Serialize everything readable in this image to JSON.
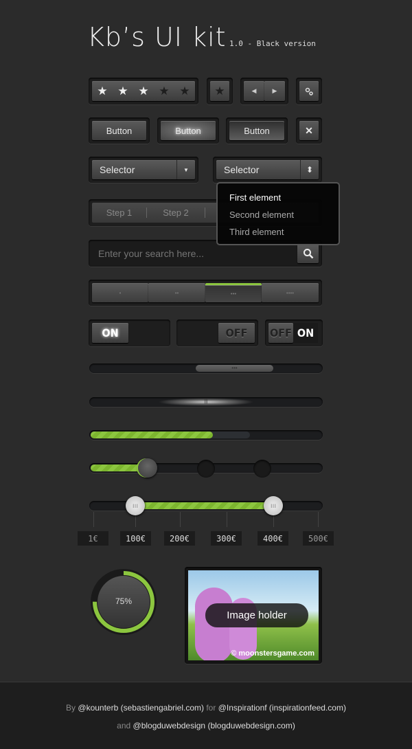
{
  "header": {
    "title": "Kb’s UI kit",
    "subtitle": "1.0 - Black version"
  },
  "rating": {
    "value": 3,
    "max": 5,
    "star_glyph": "★"
  },
  "favorite": {
    "glyph": "★"
  },
  "pager": {
    "prev": "◀",
    "next": "▶"
  },
  "buttons": [
    "Button",
    "Button",
    "Button"
  ],
  "close": {
    "glyph": "✕"
  },
  "selectors": [
    {
      "value": "Selector",
      "icon": "chevron-down-icon",
      "glyph": "▼"
    },
    {
      "value": "Selector",
      "icon": "up-down-icon",
      "glyph": "⬍"
    }
  ],
  "dropdown": {
    "items": [
      "First element",
      "Second element",
      "Third element"
    ],
    "selected": 0
  },
  "steps": [
    "Step 1",
    "Step 2"
  ],
  "search": {
    "placeholder": "Enter your search here..."
  },
  "segments": {
    "labels": [
      "•",
      "••",
      "•••",
      "••••"
    ],
    "active": 2
  },
  "toggles": [
    {
      "label": "ON",
      "state": "on"
    },
    {
      "label": "OFF",
      "state": "off"
    },
    {
      "off_label": "OFF",
      "on_label": "ON",
      "state": "on"
    }
  ],
  "scrollbar": {
    "grip": "•••"
  },
  "scrollbar2": {
    "grip": "|||"
  },
  "progress": {
    "percent": 53,
    "buffered_percent": 69
  },
  "step_slider": {
    "step": 1,
    "steps": 4
  },
  "range_slider": {
    "min_label": "100€",
    "max_label": "400€",
    "ticks": [
      "1€",
      "100€",
      "200€",
      "300€",
      "400€",
      "500€"
    ]
  },
  "circular_progress": {
    "label": "75%",
    "percent": 75
  },
  "image_holder": {
    "label": "Image holder",
    "credit": "© moonstersgame.com"
  },
  "footer": {
    "by": "By",
    "author": "@kounterb (sebastiengabriel.com)",
    "for": "for",
    "client": "@Inspirationf (inspirationfeed.com)",
    "and": "and",
    "partner": "@blogduwebdesign (blogduwebdesign.com)"
  },
  "colors": {
    "accent": "#8cc63f",
    "background": "#2b2b2b"
  }
}
